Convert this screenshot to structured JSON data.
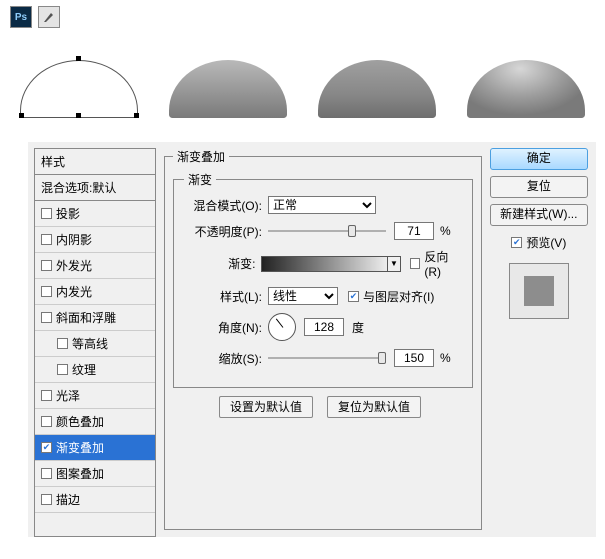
{
  "topbar": {
    "ps": "Ps",
    "tool": "pen"
  },
  "styles": {
    "header": "样式",
    "subheader": "混合选项:默认",
    "items": [
      {
        "label": "投影",
        "checked": false,
        "indent": false
      },
      {
        "label": "内阴影",
        "checked": false,
        "indent": false
      },
      {
        "label": "外发光",
        "checked": false,
        "indent": false
      },
      {
        "label": "内发光",
        "checked": false,
        "indent": false
      },
      {
        "label": "斜面和浮雕",
        "checked": false,
        "indent": false
      },
      {
        "label": "等高线",
        "checked": false,
        "indent": true
      },
      {
        "label": "纹理",
        "checked": false,
        "indent": true
      },
      {
        "label": "光泽",
        "checked": false,
        "indent": false
      },
      {
        "label": "颜色叠加",
        "checked": false,
        "indent": false
      },
      {
        "label": "渐变叠加",
        "checked": true,
        "indent": false,
        "selected": true
      },
      {
        "label": "图案叠加",
        "checked": false,
        "indent": false
      },
      {
        "label": "描边",
        "checked": false,
        "indent": false
      }
    ]
  },
  "gradient": {
    "group_title": "渐变叠加",
    "inner_title": "渐变",
    "blend_label": "混合模式(O):",
    "blend_value": "正常",
    "opacity_label": "不透明度(P):",
    "opacity_value": "71",
    "percent": "%",
    "gradient_label": "渐变:",
    "reverse_label": "反向(R)",
    "reverse_checked": false,
    "style_label": "样式(L):",
    "style_value": "线性",
    "align_label": "与图层对齐(I)",
    "align_checked": true,
    "angle_label": "角度(N):",
    "angle_value": "128",
    "degree": "度",
    "scale_label": "缩放(S):",
    "scale_value": "150",
    "set_default": "设置为默认值",
    "reset_default": "复位为默认值"
  },
  "right": {
    "ok": "确定",
    "reset": "复位",
    "new_style": "新建样式(W)...",
    "preview": "预览(V)",
    "preview_checked": true
  }
}
